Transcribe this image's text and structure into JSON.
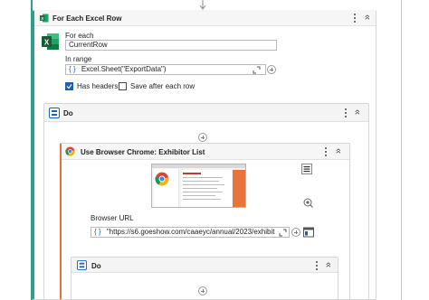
{
  "foreach": {
    "title": "For Each Excel Row",
    "for_each_label": "For each",
    "for_each_value": "CurrentRow",
    "in_range_label": "In range",
    "in_range_value": "Excel.Sheet(\"ExportData\")",
    "has_headers_label": "Has headers",
    "has_headers_checked": true,
    "save_after_label": "Save after each row",
    "save_after_checked": false
  },
  "do_outer": {
    "title": "Do"
  },
  "chrome_block": {
    "title": "Use Browser Chrome: Exhibitor List",
    "browser_url_label": "Browser URL",
    "browser_url_value": "\"https://s6.goeshow.com/caaeyc/annual/2023/exhibit"
  },
  "do_inner": {
    "title": "Do"
  },
  "glyphs": {
    "expression": "{ }",
    "collapse": "»"
  },
  "colors": {
    "foreach_accent": "#2e9e8f",
    "chrome_accent": "#e8743b",
    "excel_green": "#1e7145",
    "checkbox_blue": "#1f5fb5"
  }
}
